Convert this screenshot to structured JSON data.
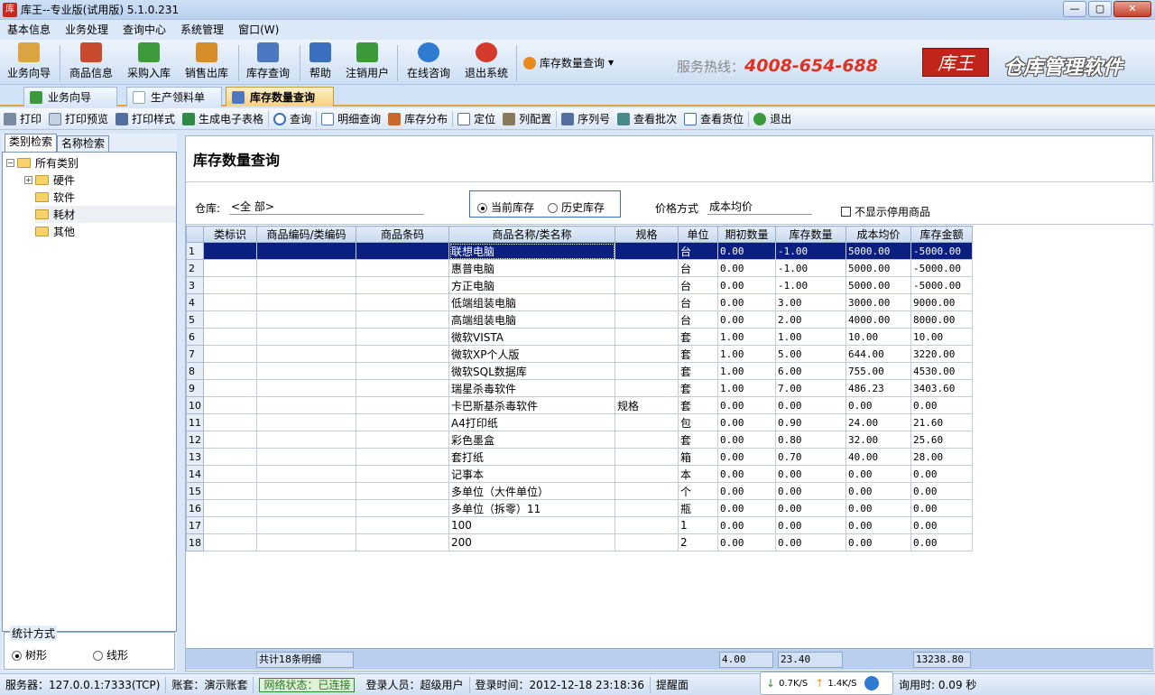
{
  "window": {
    "title": "库王--专业版(试用版)  5.1.0.231",
    "app_icon_char": "库",
    "min": "—",
    "max": "▢",
    "close": "✕"
  },
  "menu": [
    "基本信息",
    "业务处理",
    "查询中心",
    "系统管理",
    "窗口(W)"
  ],
  "toolbar": {
    "buttons": [
      {
        "label": "业务向导",
        "icon": "book-icon",
        "color": "#d9a441"
      },
      {
        "label": "商品信息",
        "icon": "goods-icon",
        "color": "#c84b2f"
      },
      {
        "label": "采购入库",
        "icon": "purchase-icon",
        "color": "#3d9a3d"
      },
      {
        "label": "销售出库",
        "icon": "sales-icon",
        "color": "#d88d2b"
      },
      {
        "label": "库存查询",
        "icon": "stock-icon",
        "color": "#4b78c0"
      },
      {
        "label": "帮助",
        "icon": "help-icon",
        "color": "#3a6fc0"
      },
      {
        "label": "注销用户",
        "icon": "logout-user-icon",
        "color": "#3c9a3c"
      },
      {
        "label": "在线咨询",
        "icon": "ie-icon",
        "color": "#2f7bd1"
      },
      {
        "label": "退出系统",
        "icon": "power-icon",
        "color": "#d33a2c"
      }
    ],
    "query_dropdown": "库存数量查询",
    "hotline_label": "服务热线：",
    "hotline_number": "4008-654-688",
    "brand_logo": "库王",
    "brand_text": "仓库管理软件"
  },
  "tabs": [
    {
      "label": "业务向导",
      "active": false
    },
    {
      "label": "生产领料单",
      "active": false
    },
    {
      "label": "库存数量查询",
      "active": true
    }
  ],
  "subtoolbar": [
    "打印",
    "打印预览",
    "打印样式",
    "生成电子表格",
    "查询",
    "明细查询",
    "库存分布",
    "定位",
    "列配置",
    "序列号",
    "查看批次",
    "查看货位",
    "退出"
  ],
  "left": {
    "tabs": [
      "类别检索",
      "名称检索"
    ],
    "tree": [
      {
        "label": "所有类别",
        "level": 0,
        "exp": "−"
      },
      {
        "label": "硬件",
        "level": 1,
        "exp": "+"
      },
      {
        "label": "软件",
        "level": 1,
        "exp": ""
      },
      {
        "label": "耗材",
        "level": 1,
        "exp": "",
        "selected": true
      },
      {
        "label": "其他",
        "level": 1,
        "exp": ""
      }
    ],
    "stat_title": "统计方式",
    "stat_tree": "树形",
    "stat_line": "线形"
  },
  "main": {
    "title": "库存数量查询",
    "warehouse_label": "仓库:",
    "warehouse_value": "<全  部>",
    "radio_current": "当前库存",
    "radio_history": "历史库存",
    "price_label": "价格方式",
    "price_value": "成本均价",
    "hide_disabled": "不显示停用商品"
  },
  "grid": {
    "columns": [
      "类标识",
      "商品编码/类编码",
      "商品条码",
      "商品名称/类名称",
      "规格",
      "单位",
      "期初数量",
      "库存数量",
      "成本均价",
      "库存金额"
    ],
    "rows": [
      [
        "1",
        "",
        "",
        "",
        "联想电脑",
        "",
        "台",
        "0.00",
        "-1.00",
        "5000.00",
        "-5000.00"
      ],
      [
        "2",
        "",
        "",
        "",
        "惠普电脑",
        "",
        "台",
        "0.00",
        "-1.00",
        "5000.00",
        "-5000.00"
      ],
      [
        "3",
        "",
        "",
        "",
        "方正电脑",
        "",
        "台",
        "0.00",
        "-1.00",
        "5000.00",
        "-5000.00"
      ],
      [
        "4",
        "",
        "",
        "",
        "低端组装电脑",
        "",
        "台",
        "0.00",
        "3.00",
        "3000.00",
        "9000.00"
      ],
      [
        "5",
        "",
        "",
        "",
        "高端组装电脑",
        "",
        "台",
        "0.00",
        "2.00",
        "4000.00",
        "8000.00"
      ],
      [
        "6",
        "",
        "",
        "",
        "微软VISTA",
        "",
        "套",
        "1.00",
        "1.00",
        "10.00",
        "10.00"
      ],
      [
        "7",
        "",
        "",
        "",
        "微软XP个人版",
        "",
        "套",
        "1.00",
        "5.00",
        "644.00",
        "3220.00"
      ],
      [
        "8",
        "",
        "",
        "",
        "微软SQL数据库",
        "",
        "套",
        "1.00",
        "6.00",
        "755.00",
        "4530.00"
      ],
      [
        "9",
        "",
        "",
        "",
        "瑞星杀毒软件",
        "",
        "套",
        "1.00",
        "7.00",
        "486.23",
        "3403.60"
      ],
      [
        "10",
        "",
        "",
        "",
        "卡巴斯基杀毒软件",
        "规格",
        "套",
        "0.00",
        "0.00",
        "0.00",
        "0.00"
      ],
      [
        "11",
        "",
        "",
        "",
        "A4打印纸",
        "",
        "包",
        "0.00",
        "0.90",
        "24.00",
        "21.60"
      ],
      [
        "12",
        "",
        "",
        "",
        "彩色墨盒",
        "",
        "套",
        "0.00",
        "0.80",
        "32.00",
        "25.60"
      ],
      [
        "13",
        "",
        "",
        "",
        "套打纸",
        "",
        "箱",
        "0.00",
        "0.70",
        "40.00",
        "28.00"
      ],
      [
        "14",
        "",
        "",
        "",
        "记事本",
        "",
        "本",
        "0.00",
        "0.00",
        "0.00",
        "0.00"
      ],
      [
        "15",
        "",
        "",
        "",
        "多单位（大件单位）",
        "",
        "个",
        "0.00",
        "0.00",
        "0.00",
        "0.00"
      ],
      [
        "16",
        "",
        "",
        "",
        "多单位（拆零）11",
        "",
        "瓶",
        "0.00",
        "0.00",
        "0.00",
        "0.00"
      ],
      [
        "17",
        "",
        "",
        "",
        "100",
        "",
        "1",
        "0.00",
        "0.00",
        "0.00",
        "0.00"
      ],
      [
        "18",
        "",
        "",
        "",
        "200",
        "",
        "2",
        "0.00",
        "0.00",
        "0.00",
        "0.00"
      ]
    ],
    "footer_count": "共计18条明细",
    "footer_initial": "4.00",
    "footer_qty": "23.40",
    "footer_amount": "13238.80"
  },
  "status": {
    "server": "服务器：127.0.0.1:7333(TCP)",
    "account": "账套：演示账套",
    "network": "网络状态：已连接",
    "user": "登录人员：超级用户",
    "login_time": "登录时间：2012-12-18 23:18:36",
    "reminder": "提醒面",
    "down_speed": "0.7K/S",
    "up_speed": "1.4K/S",
    "query_time": "询用时: 0.09 秒"
  }
}
